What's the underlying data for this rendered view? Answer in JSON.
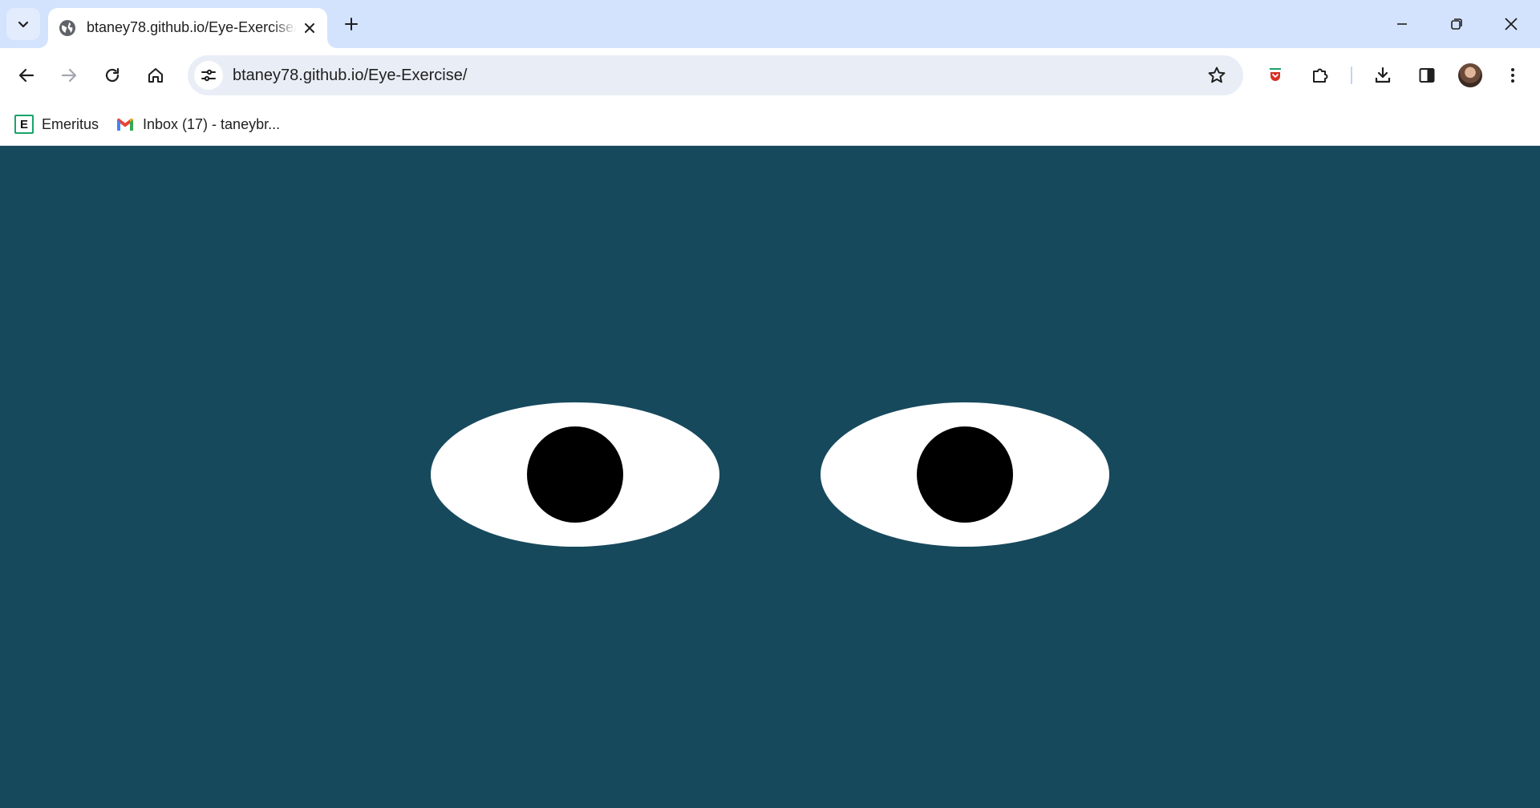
{
  "browser": {
    "tab": {
      "title": "btaney78.github.io/Eye-Exercise/"
    },
    "address_bar": {
      "url": "btaney78.github.io/Eye-Exercise/"
    },
    "bookmarks": [
      {
        "label": "Emeritus",
        "icon": "emeritus-e-icon"
      },
      {
        "label": "Inbox (17) - taneybr...",
        "icon": "gmail-icon"
      }
    ],
    "colors": {
      "tabstrip": "#d3e3fd",
      "toolbar": "#ffffff",
      "omnibox": "#e9eef6"
    }
  },
  "page": {
    "background_color": "#17495d",
    "eyes": [
      {
        "name": "left-eye",
        "sclera_color": "#ffffff",
        "pupil_color": "#000000"
      },
      {
        "name": "right-eye",
        "sclera_color": "#ffffff",
        "pupil_color": "#000000"
      }
    ]
  }
}
